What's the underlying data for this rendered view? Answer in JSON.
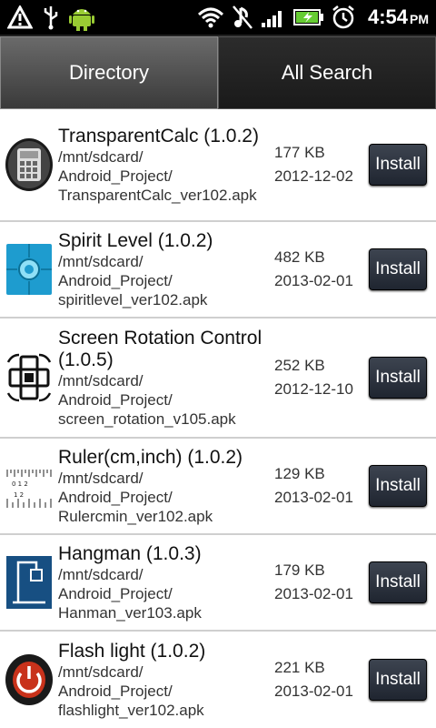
{
  "status": {
    "time": "4:54",
    "ampm": "PM"
  },
  "tabs": [
    {
      "label": "Directory",
      "active": true
    },
    {
      "label": "All Search",
      "active": false
    }
  ],
  "apps": [
    {
      "name": "TransparentCalc (1.0.2)",
      "path": [
        "/mnt/sdcard/",
        "Android_Project/",
        "TransparentCalc_ver102.apk"
      ],
      "size": "177 KB",
      "date": "2012-12-02",
      "action": "Install",
      "icon": "calculator-icon"
    },
    {
      "name": "Spirit Level (1.0.2)",
      "path": [
        "/mnt/sdcard/",
        "Android_Project/",
        "spiritlevel_ver102.apk"
      ],
      "size": "482 KB",
      "date": "2013-02-01",
      "action": "Install",
      "icon": "spirit-level-icon"
    },
    {
      "name": "Screen Rotation Control (1.0.5)",
      "path": [
        "/mnt/sdcard/",
        "Android_Project/",
        "screen_rotation_v105.apk"
      ],
      "size": "252 KB",
      "date": "2012-12-10",
      "action": "Install",
      "icon": "rotation-icon"
    },
    {
      "name": "Ruler(cm,inch) (1.0.2)",
      "path": [
        "/mnt/sdcard/",
        "Android_Project/",
        "Rulercmin_ver102.apk"
      ],
      "size": "129 KB",
      "date": "2013-02-01",
      "action": "Install",
      "icon": "ruler-icon"
    },
    {
      "name": "Hangman (1.0.3)",
      "path": [
        "/mnt/sdcard/",
        "Android_Project/",
        "Hanman_ver103.apk"
      ],
      "size": "179 KB",
      "date": "2013-02-01",
      "action": "Install",
      "icon": "hangman-icon"
    },
    {
      "name": "Flash light (1.0.2)",
      "path": [
        "/mnt/sdcard/",
        "Android_Project/",
        "flashlight_ver102.apk"
      ],
      "size": "221 KB",
      "date": "2013-02-01",
      "action": "Install",
      "icon": "flashlight-icon"
    }
  ]
}
